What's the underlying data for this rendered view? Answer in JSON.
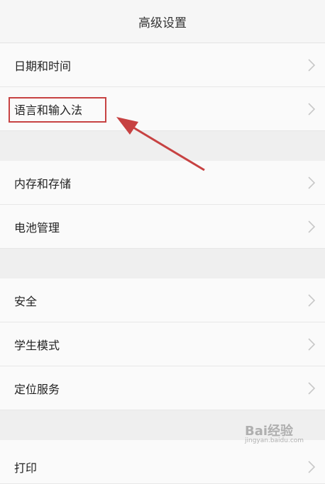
{
  "header": {
    "title": "高级设置"
  },
  "rows": [
    {
      "label": "日期和时间"
    },
    {
      "label": "语言和输入法"
    },
    {
      "label": "内存和存储"
    },
    {
      "label": "电池管理"
    },
    {
      "label": "安全"
    },
    {
      "label": "学生模式"
    },
    {
      "label": "定位服务"
    },
    {
      "label": "打印"
    }
  ],
  "annotation": {
    "color": "#c74242"
  },
  "watermark": {
    "brand": "Bai经验",
    "site": "jingyan.baidu.com"
  },
  "icons": {
    "row_chevron": "chevron-right-icon"
  }
}
